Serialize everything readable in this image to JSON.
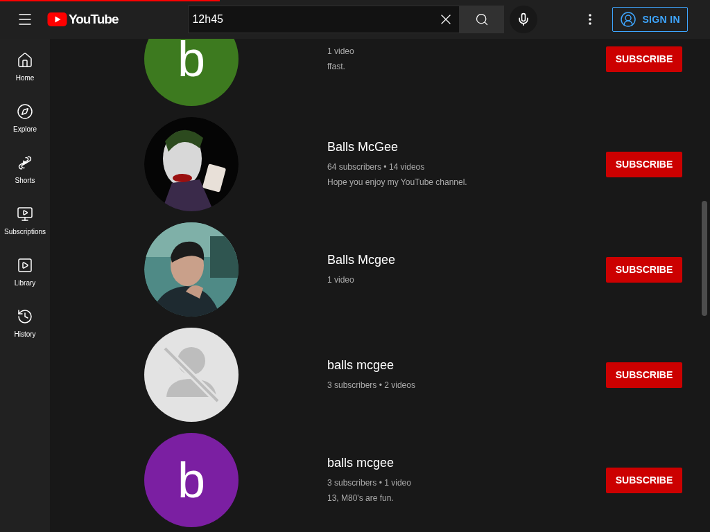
{
  "loading_bar": {
    "level": 0.31
  },
  "header": {
    "logo": "YouTube",
    "search": {
      "value": "12h45"
    },
    "sign_in": "SIGN IN"
  },
  "sidebar": {
    "items": [
      {
        "kind": "home",
        "label": "Home"
      },
      {
        "kind": "explore",
        "label": "Explore"
      },
      {
        "kind": "shorts",
        "label": "Shorts"
      },
      {
        "kind": "subscriptions",
        "label": "Subscriptions"
      },
      {
        "kind": "library",
        "label": "Library"
      },
      {
        "kind": "history",
        "label": "History"
      }
    ]
  },
  "channels": [
    {
      "avatar": {
        "kind": "letter",
        "letter": "b",
        "color": "#3d7a1f"
      },
      "meta": "1 video",
      "description": "ffast.",
      "button": "SUBSCRIBE"
    },
    {
      "name": "Balls McGee",
      "meta": "64 subscribers • 14 videos",
      "description": "Hope you enjoy my YouTube channel.",
      "button": "SUBSCRIBE"
    },
    {
      "name": "Balls Mcgee",
      "meta": "1 video",
      "button": "SUBSCRIBE"
    },
    {
      "avatar": {
        "kind": "default"
      },
      "name": "balls mcgee",
      "meta": "3 subscribers • 2 videos",
      "button": "SUBSCRIBE"
    },
    {
      "avatar": {
        "kind": "letter",
        "letter": "b",
        "color": "#7b1fa2"
      },
      "name": "balls mcgee",
      "meta": "3 subscribers • 1 video",
      "description": "13, M80's are fun.",
      "button": "SUBSCRIBE"
    }
  ]
}
